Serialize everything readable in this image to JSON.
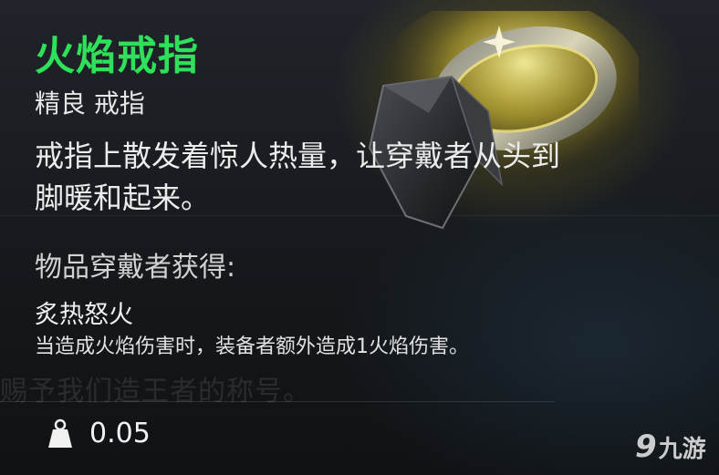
{
  "item": {
    "name": "火焰戒指",
    "type": "精良 戒指",
    "description_line1": "戒指上散发着惊人热量，让穿戴者从头到",
    "description_line2": "脚暖和起来。",
    "name_color": "#2fe05a"
  },
  "effects": {
    "header": "物品穿戴者获得:",
    "items": [
      {
        "name": "炙热怒火",
        "description": "当造成火焰伤害时，装备者额外造成1火焰伤害。"
      }
    ]
  },
  "weight": {
    "icon": "weight-icon",
    "value": "0.05"
  },
  "background_text": "赐予我们造王者的称号。",
  "watermark": {
    "logo": "9",
    "text": "九游"
  }
}
